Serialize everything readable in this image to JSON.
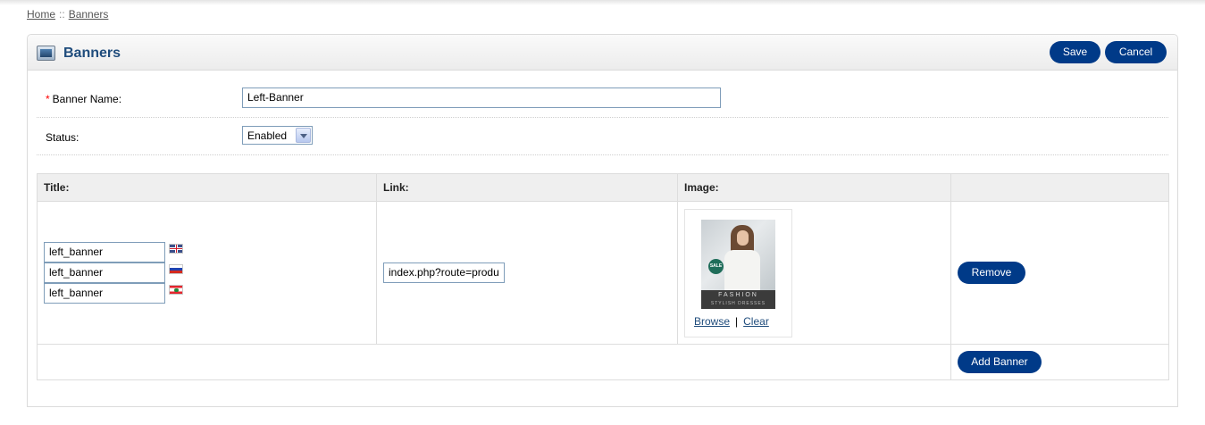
{
  "breadcrumb": {
    "home": "Home",
    "separator": "::",
    "current": "Banners"
  },
  "header": {
    "title": "Banners",
    "icon": "banner-monitor-icon",
    "save_label": "Save",
    "cancel_label": "Cancel"
  },
  "form": {
    "required_mark": "*",
    "name_label": "Banner Name:",
    "name_value": "Left-Banner",
    "status_label": "Status:",
    "status_value": "Enabled"
  },
  "table": {
    "headers": {
      "title": "Title:",
      "link": "Link:",
      "image": "Image:",
      "actions": ""
    },
    "rows": [
      {
        "titles": [
          {
            "value": "left_banner",
            "flag": "uk-flag-icon"
          },
          {
            "value": "left_banner",
            "flag": "russia-flag-icon"
          },
          {
            "value": "left_banner",
            "flag": "lebanon-flag-icon"
          }
        ],
        "link": "index.php?route=produ",
        "image": {
          "sale_text": "SALE",
          "caption1": "FASHION",
          "caption2": "STYLISH DRESSES",
          "browse_label": "Browse",
          "separator": "|",
          "clear_label": "Clear"
        },
        "remove_label": "Remove"
      }
    ],
    "add_label": "Add Banner"
  },
  "colors": {
    "button": "#003a88",
    "title": "#1f4c7c",
    "required": "#ff0000"
  }
}
